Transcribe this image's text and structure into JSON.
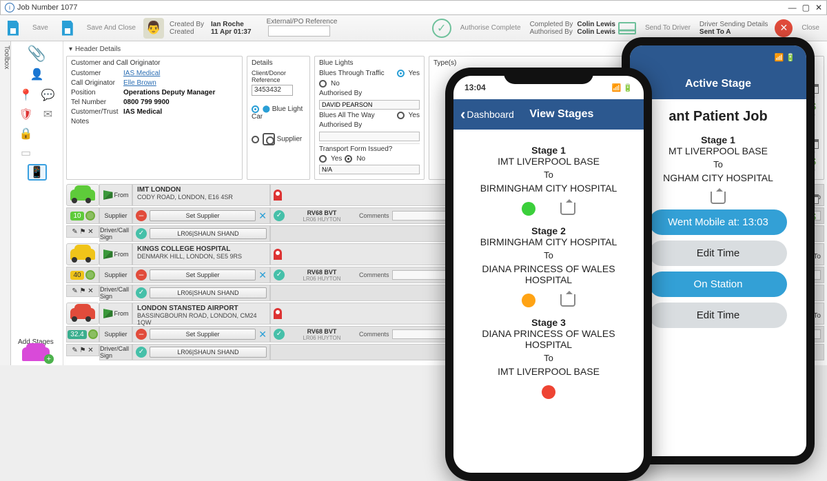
{
  "window": {
    "title": "Job Number 1077"
  },
  "ribbon": {
    "save": "Save",
    "save_close": "Save And Close",
    "created_by_k": "Created By",
    "created_by_v": "Ian Roche",
    "created_k": "Created",
    "created_v": "11 Apr 01:37",
    "ext_ref_k": "External/PO Reference",
    "authorise": "Authorise Complete",
    "completed_by_k": "Completed By",
    "completed_by_v": "Colin Lewis",
    "authorised_by_k": "Authorised By",
    "authorised_by_v": "Colin Lewis",
    "send_to_driver": "Send To Driver",
    "driver_send_k": "Driver Sending Details",
    "driver_send_v": "Sent To A",
    "close": "Close"
  },
  "toolbox_label": "Toolbox",
  "header_details": "Header Details",
  "cust_panel": {
    "title": "Customer and Call Originator",
    "customer_k": "Customer",
    "customer_v": "IAS Medical",
    "callorig_k": "Call Originator",
    "callorig_v": "Elle Brown",
    "position_k": "Position",
    "position_v": "Operations Deputy Manager",
    "tel_k": "Tel Number",
    "tel_v": "0800 799 9900",
    "trust_k": "Customer/Trust",
    "trust_v": "IAS Medical",
    "notes_k": "Notes"
  },
  "details": {
    "title": "Details",
    "client_ref_k": "Client/Donor Reference",
    "client_ref_v": "3453432",
    "blue_car": "Blue Light Car",
    "supplier": "Supplier"
  },
  "blue": {
    "title": "Blue Lights",
    "through_k": "Blues Through Traffic",
    "yes": "Yes",
    "no": "No",
    "auth_k": "Authorised By",
    "auth_v": "DAVID PEARSON",
    "allway_k": "Blues All The Way",
    "form_k": "Transport Form Issued?",
    "na": "N/A"
  },
  "types": {
    "title": "Type(s)"
  },
  "stages": [
    {
      "color": "green",
      "badge": "10",
      "loc1": "IMT LONDON",
      "loc2": "CODY ROAD, LONDON, E16 4SR"
    },
    {
      "color": "yellow",
      "badge": "40",
      "loc1": "KINGS COLLEGE HOSPITAL",
      "loc2": "DENMARK HILL, LONDON, SE5 9RS"
    },
    {
      "color": "red",
      "badge": "32.4",
      "loc1": "LONDON STANSTED AIRPORT",
      "loc2": "BASSINGBOURN ROAD, LONDON, CM24 1QW"
    }
  ],
  "stage_common": {
    "from": "From",
    "to": "To",
    "supplier": "Supplier",
    "driver": "Driver/Call Sign",
    "set_supplier": "Set Supplier",
    "reg": "RV68 BVT",
    "reg2": "LR06 HUYTON",
    "callsign": "LR06|SHAUN SHAND",
    "comments": "Comments"
  },
  "add_stages": "Add Stages",
  "phone1": {
    "time": "13:04",
    "back": "Dashboard",
    "title": "View Stages",
    "s1": "Stage  1",
    "s1a": "IMT LIVERPOOL BASE",
    "to": "To",
    "s1b": "BIRMINGHAM CITY HOSPITAL",
    "s2": "Stage  2",
    "s2a": "BIRMINGHAM CITY HOSPITAL",
    "s2b": "DIANA PRINCESS OF WALES HOSPITAL",
    "s3": "Stage  3",
    "s3a": "DIANA PRINCESS OF WALES HOSPITAL",
    "s3b": "IMT LIVERPOOL BASE"
  },
  "phone2": {
    "title": "Active Stage",
    "job": "ant Patient Job",
    "s1": "Stage  1",
    "s1a": "MT LIVERPOOL BASE",
    "to": "To",
    "s1b": "NGHAM CITY HOSPITAL",
    "b1": "Went Mobile at: 13:03",
    "b2": "Edit Time",
    "b3": "On Station",
    "b4": "Edit Time"
  }
}
